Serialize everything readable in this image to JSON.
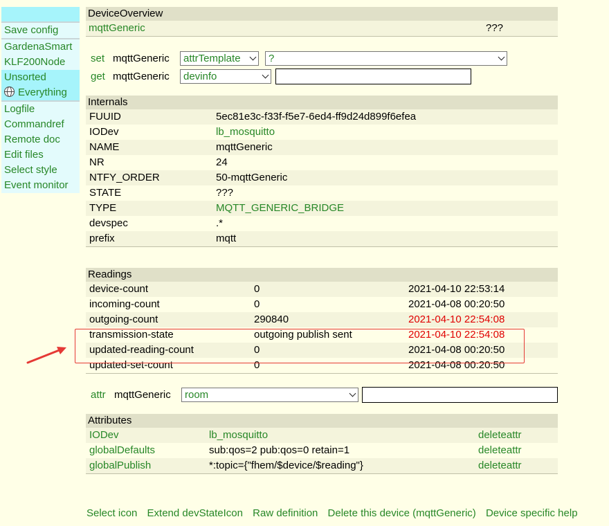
{
  "menu": {
    "save_config": "Save config",
    "rooms": [
      "GardenaSmart",
      "KLF200Node",
      "Unsorted",
      "Everything"
    ],
    "tools": [
      "Logfile",
      "Commandref",
      "Remote doc",
      "Edit files",
      "Select style",
      "Event monitor"
    ]
  },
  "overview": {
    "title": "DeviceOverview",
    "device": "mqttGeneric",
    "state": "???"
  },
  "set_cmd": {
    "verb": "set",
    "device": "mqttGeneric",
    "option": "attrTemplate",
    "value": "?"
  },
  "get_cmd": {
    "verb": "get",
    "device": "mqttGeneric",
    "option": "devinfo",
    "input": ""
  },
  "internals": {
    "title": "Internals",
    "rows": [
      {
        "name": "FUUID",
        "value": "5ec81e3c-f33f-f5e7-6ed4-ff9d24d899f6efea",
        "link": false
      },
      {
        "name": "IODev",
        "value": "lb_mosquitto",
        "link": true
      },
      {
        "name": "NAME",
        "value": "mqttGeneric",
        "link": false
      },
      {
        "name": "NR",
        "value": "24",
        "link": false
      },
      {
        "name": "NTFY_ORDER",
        "value": "50-mqttGeneric",
        "link": false
      },
      {
        "name": "STATE",
        "value": "???",
        "link": false
      },
      {
        "name": "TYPE",
        "value": "MQTT_GENERIC_BRIDGE",
        "link": true
      },
      {
        "name": "devspec",
        "value": ".*",
        "link": false
      },
      {
        "name": "prefix",
        "value": "mqtt",
        "link": false
      }
    ]
  },
  "readings": {
    "title": "Readings",
    "rows": [
      {
        "name": "device-count",
        "value": "0",
        "time": "2021-04-10 22:53:14",
        "highlight": false
      },
      {
        "name": "incoming-count",
        "value": "0",
        "time": "2021-04-08 00:20:50",
        "highlight": false
      },
      {
        "name": "outgoing-count",
        "value": "290840",
        "time": "2021-04-10 22:54:08",
        "highlight": true
      },
      {
        "name": "transmission-state",
        "value": "outgoing publish sent",
        "time": "2021-04-10 22:54:08",
        "highlight": true
      },
      {
        "name": "updated-reading-count",
        "value": "0",
        "time": "2021-04-08 00:20:50",
        "highlight": false
      },
      {
        "name": "updated-set-count",
        "value": "0",
        "time": "2021-04-08 00:20:50",
        "highlight": false
      }
    ]
  },
  "attr_cmd": {
    "verb": "attr",
    "device": "mqttGeneric",
    "option": "room",
    "input": ""
  },
  "attributes": {
    "title": "Attributes",
    "delete_label": "deleteattr",
    "rows": [
      {
        "name": "IODev",
        "value": "lb_mosquitto",
        "link": true
      },
      {
        "name": "globalDefaults",
        "value": "sub:qos=2 pub:qos=0 retain=1",
        "link": false
      },
      {
        "name": "globalPublish",
        "value": "*:topic={\"fhem/$device/$reading\"}",
        "link": false
      }
    ]
  },
  "bottom_links": [
    "Select icon",
    "Extend devStateIcon",
    "Raw definition",
    "Delete this device (mqttGeneric)",
    "Device specific help"
  ],
  "colors": {
    "link": "#278727",
    "highlight_time": "#e00000",
    "annotation": "#e53935",
    "menu_selected": "#a6f4fb",
    "background": "#ffffe7"
  }
}
